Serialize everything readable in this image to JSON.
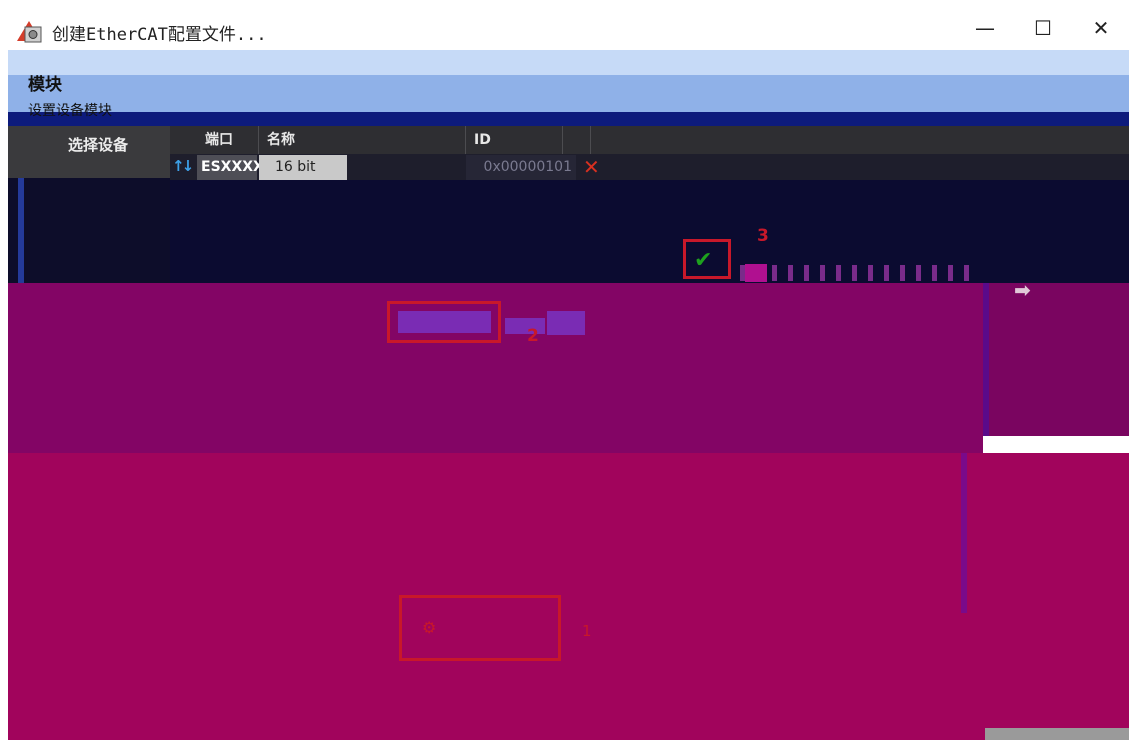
{
  "window": {
    "title": "创建EtherCAT配置文件...",
    "minimize": "—",
    "maximize": "☐",
    "close": "✕"
  },
  "header": {
    "title": "模块",
    "subtitle": "设置设备模块"
  },
  "tree": {
    "label": "选择设备"
  },
  "grid": {
    "columns": [
      "端口",
      "名称",
      "ID"
    ],
    "rows": [
      {
        "port": "ESXXXX",
        "name": "16 bit",
        "id": "0x00000101"
      }
    ]
  },
  "markers": {
    "one": "1",
    "two": "2",
    "three": "3"
  },
  "icons": {
    "move": "↑↓",
    "delete": "✕",
    "confirm": "✔",
    "next": "➡",
    "settings": "⚙"
  },
  "colors": {
    "marker_red": "#c8182a",
    "purple_region": "#830565",
    "magenta_region": "#a1045c"
  }
}
